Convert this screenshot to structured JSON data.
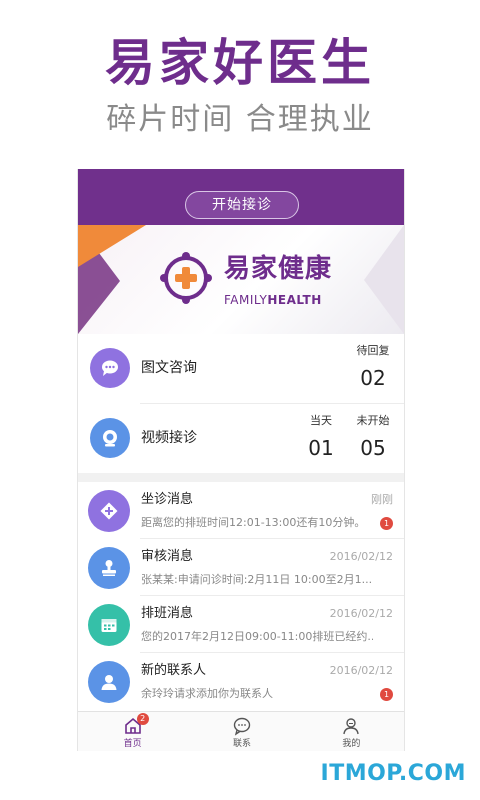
{
  "headline": "易家好医生",
  "subline": "碎片时间 合理执业",
  "topbar": {
    "start_button": "开始接诊"
  },
  "banner": {
    "logo_cn": "易家健康",
    "logo_en_a": "FAMILY",
    "logo_en_b": "HEALTH"
  },
  "stats": {
    "consult": {
      "label": "图文咨询",
      "pending_caption": "待回复",
      "pending_value": "02",
      "icon": "chat-bubble-icon"
    },
    "video": {
      "label": "视频接诊",
      "today_caption": "当天",
      "today_value": "01",
      "notstarted_caption": "未开始",
      "notstarted_value": "05",
      "icon": "camera-icon"
    }
  },
  "messages": [
    {
      "title": "坐诊消息",
      "time": "刚刚",
      "preview": "距离您的排班时间12:01-13:00还有10分钟。",
      "badge": "1",
      "color": "#8f72e0",
      "icon": "diamond-plus-icon"
    },
    {
      "title": "审核消息",
      "time": "2016/02/12",
      "preview": "张某某:申请问诊时间:2月11日 10:00至2月1...",
      "badge": "",
      "color": "#5b93e6",
      "icon": "stamp-icon"
    },
    {
      "title": "排班消息",
      "time": "2016/02/12",
      "preview": "您的2017年2月12日09:00-11:00排班已经约...",
      "badge": "",
      "color": "#35c0a8",
      "icon": "calendar-icon"
    },
    {
      "title": "新的联系人",
      "time": "2016/02/12",
      "preview": "余玲玲请求添加你为联系人",
      "badge": "1",
      "color": "#5b93e6",
      "icon": "person-icon"
    }
  ],
  "tabs": [
    {
      "label": "首页",
      "badge": "2",
      "icon": "home-icon"
    },
    {
      "label": "联系",
      "icon": "chat-icon"
    },
    {
      "label": "我的",
      "icon": "profile-icon"
    }
  ],
  "watermark": "ITMOP.COM",
  "colors": {
    "brand": "#6e2d8c",
    "orange": "#f08a3a",
    "badge": "#e04a3f"
  }
}
